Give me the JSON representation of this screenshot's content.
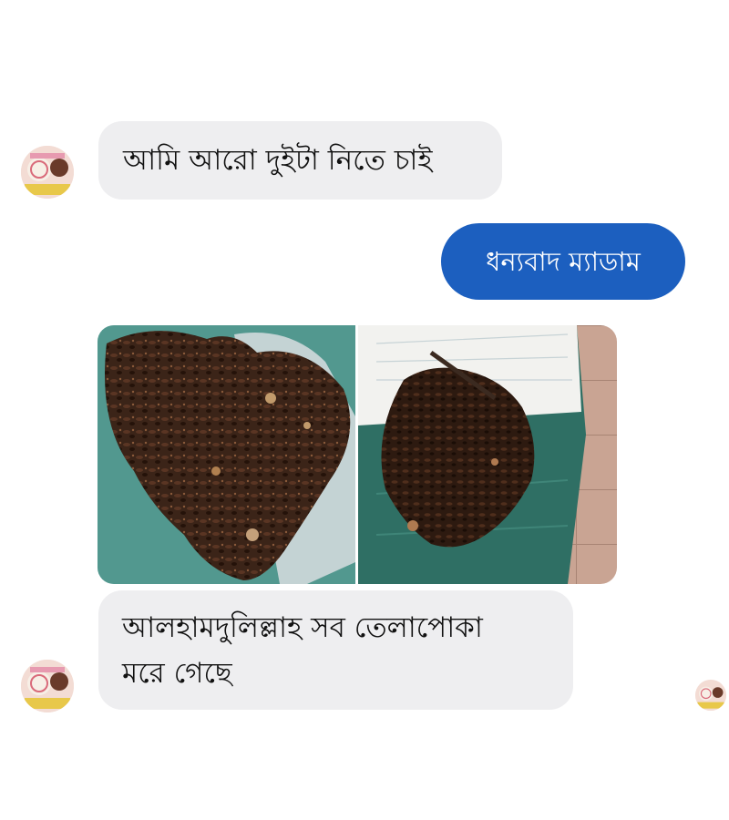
{
  "conversation": {
    "messages": [
      {
        "sender": "contact",
        "type": "text",
        "text": "আমি আরো দুইটা নিতে চাই"
      },
      {
        "sender": "me",
        "type": "text",
        "text": "ধন্যবাদ ম্যাডাম"
      },
      {
        "sender": "contact",
        "type": "photos",
        "count": 2
      },
      {
        "sender": "contact",
        "type": "text",
        "line1": "আলহামদুলিল্লাহ সব তেলাপোকা",
        "line2": "মরে গেছে"
      }
    ],
    "colors": {
      "outgoing_bubble": "#1c5fbf",
      "incoming_bubble": "#eeeef0"
    },
    "icons": [
      "contact-avatar",
      "read-receipt-avatar"
    ]
  }
}
